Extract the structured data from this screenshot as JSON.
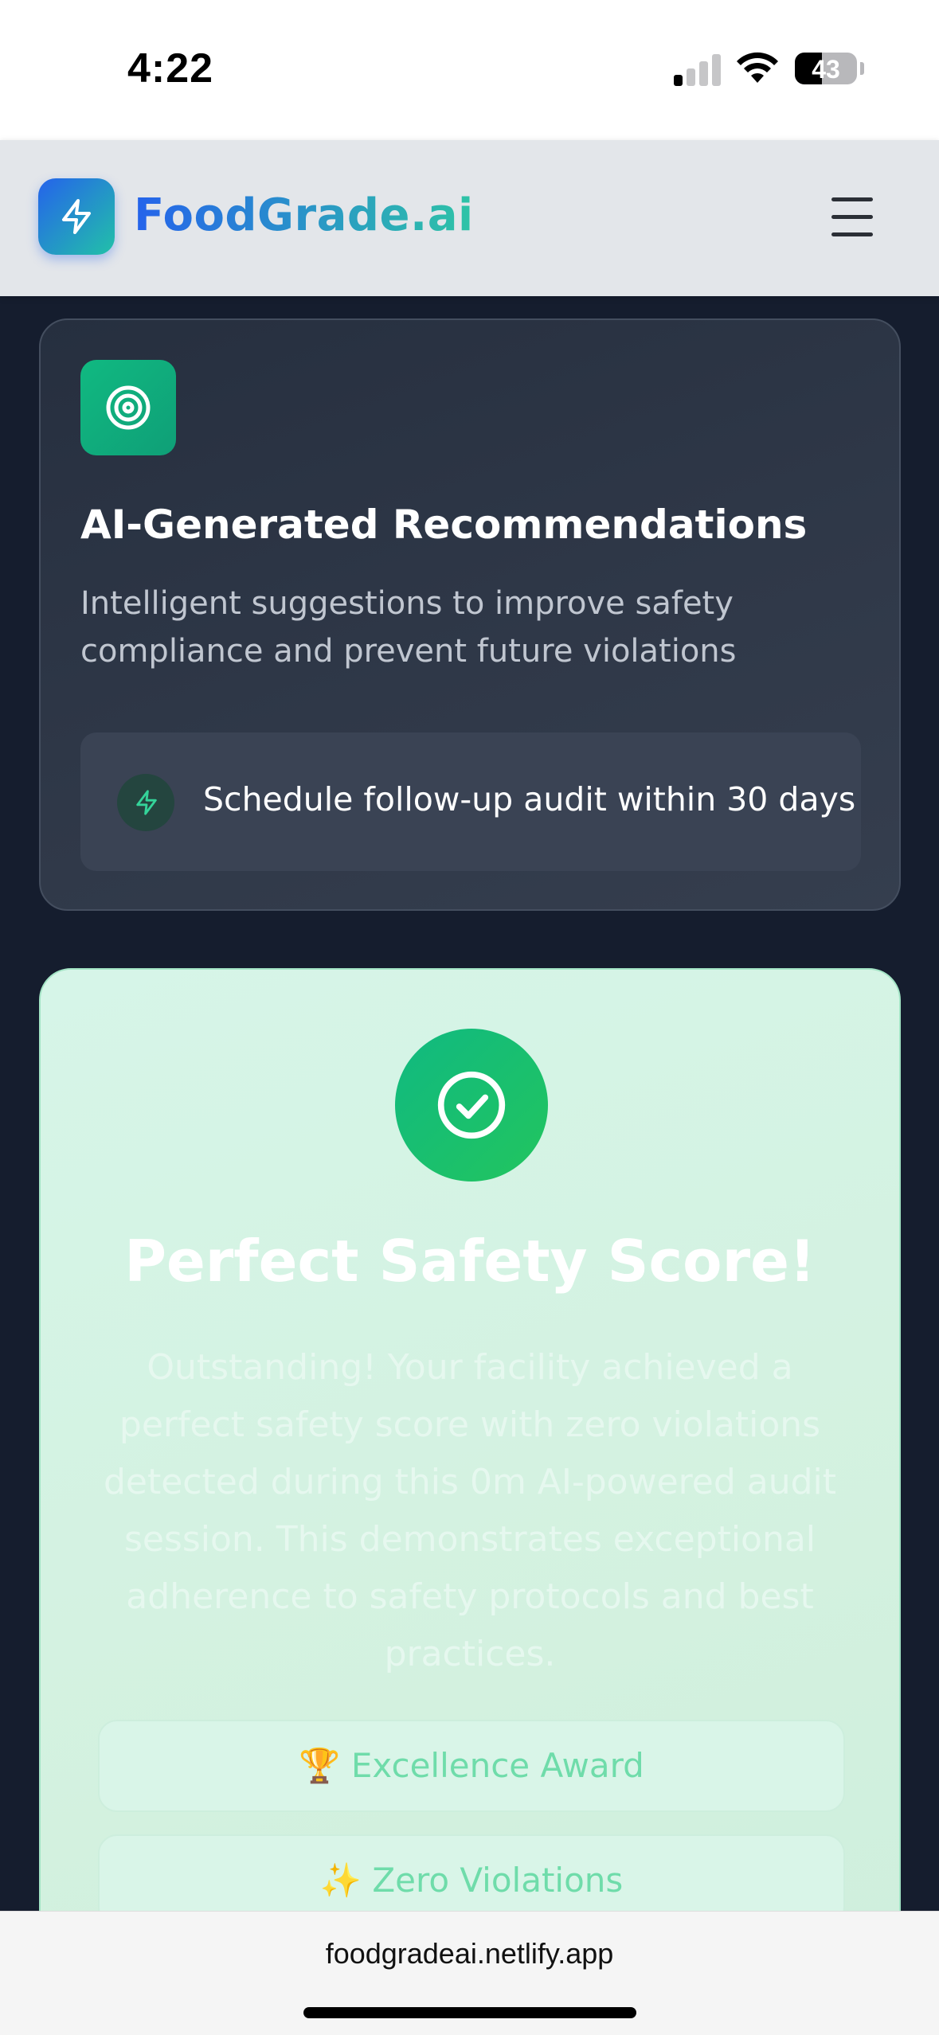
{
  "status_bar": {
    "time": "4:22",
    "battery_percent": "43",
    "signal_bars_active": 1
  },
  "header": {
    "brand": "FoodGrade.ai",
    "logo_icon": "lightning-bolt-icon",
    "menu_icon": "hamburger-menu-icon",
    "brand_colors": [
      "#2563eb",
      "#2ec4a6"
    ]
  },
  "recommendations": {
    "icon": "target-icon",
    "title": "AI-Generated Recommendations",
    "description_lines": [
      "Intelligent suggestions to improve safety",
      "compliance and prevent future violations"
    ],
    "items": [
      {
        "icon": "lightning-bolt-icon",
        "text": "Schedule follow-up audit within 30 days"
      }
    ]
  },
  "score": {
    "icon": "check-circle-icon",
    "title": "Perfect Safety Score!",
    "description_lines": [
      "Outstanding! Your facility achieved a",
      "perfect safety score with zero violations",
      "detected during this 0m AI-powered audit",
      "session. This demonstrates exceptional",
      "adherence to safety protocols and best",
      "practices."
    ],
    "badges": [
      {
        "emoji": "🏆",
        "label": "Excellence Award"
      },
      {
        "emoji": "✨",
        "label": "Zero Violations"
      }
    ],
    "accent": "#10b981"
  },
  "browser": {
    "url": "foodgradeai.netlify.app"
  }
}
